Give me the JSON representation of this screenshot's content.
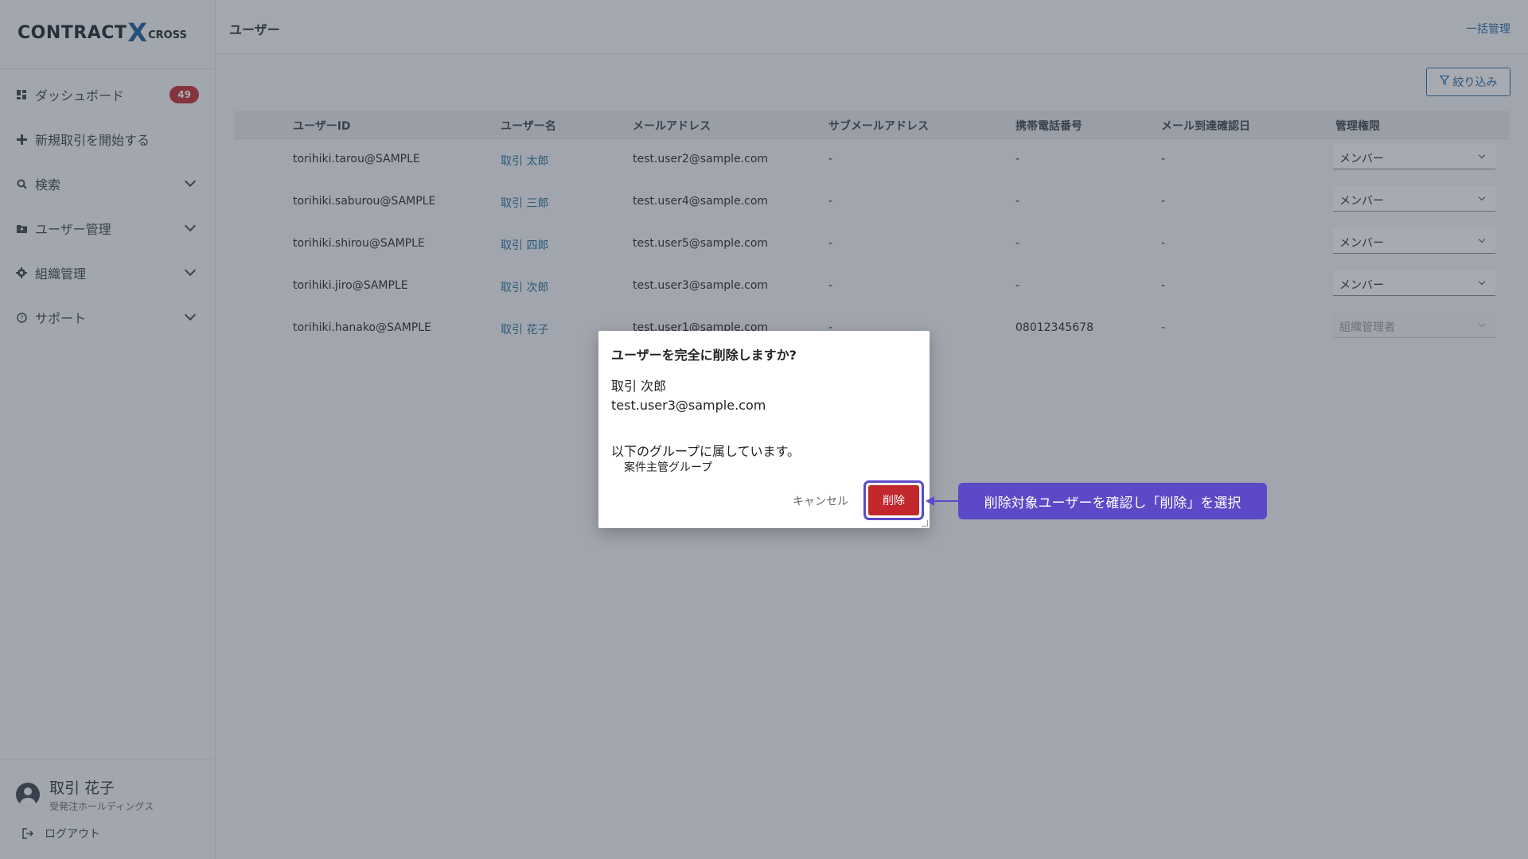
{
  "sidebar": {
    "logo": {
      "main": "CONTRACT",
      "x": "X",
      "sub": "CROSS"
    },
    "items": [
      {
        "label": "ダッシュボード",
        "badge": "49"
      },
      {
        "label": "新規取引を開始する"
      },
      {
        "label": "検索"
      },
      {
        "label": "ユーザー管理"
      },
      {
        "label": "組織管理"
      },
      {
        "label": "サポート"
      }
    ],
    "profile": {
      "name": "取引 花子",
      "org": "受発注ホールディングス"
    },
    "logout_label": "ログアウト"
  },
  "header": {
    "title": "ユーザー",
    "bulk_label": "一括管理"
  },
  "toolbar": {
    "filter_label": "絞り込み"
  },
  "table": {
    "columns": [
      "ユーザーID",
      "ユーザー名",
      "メールアドレス",
      "サブメールアドレス",
      "携帯電話番号",
      "メール到達確認日",
      "管理権限"
    ],
    "rows": [
      {
        "id": "torihiki.tarou@SAMPLE",
        "name": "取引 太郎",
        "email": "test.user2@sample.com",
        "sub_email": "-",
        "phone": "-",
        "confirmed": "-",
        "role": "メンバー",
        "disabled": false
      },
      {
        "id": "torihiki.saburou@SAMPLE",
        "name": "取引 三郎",
        "email": "test.user4@sample.com",
        "sub_email": "-",
        "phone": "-",
        "confirmed": "-",
        "role": "メンバー",
        "disabled": false
      },
      {
        "id": "torihiki.shirou@SAMPLE",
        "name": "取引 四郎",
        "email": "test.user5@sample.com",
        "sub_email": "-",
        "phone": "-",
        "confirmed": "-",
        "role": "メンバー",
        "disabled": false
      },
      {
        "id": "torihiki.jiro@SAMPLE",
        "name": "取引 次郎",
        "email": "test.user3@sample.com",
        "sub_email": "-",
        "phone": "-",
        "confirmed": "-",
        "role": "メンバー",
        "disabled": false
      },
      {
        "id": "torihiki.hanako@SAMPLE",
        "name": "取引 花子",
        "email": "test.user1@sample.com",
        "sub_email": "-",
        "phone": "08012345678",
        "confirmed": "-",
        "role": "組織管理者",
        "disabled": true
      }
    ]
  },
  "modal": {
    "title": "ユーザーを完全に削除しますか?",
    "user_name": "取引 次郎",
    "user_email": "test.user3@sample.com",
    "group_label": "以下のグループに属しています。",
    "group_name": "案件主管グループ",
    "cancel_label": "キャンセル",
    "delete_label": "削除"
  },
  "annotation": {
    "text": "削除対象ユーザーを確認し「削除」を選択"
  },
  "colors": {
    "accent": "#1e64a8",
    "danger": "#c2272d",
    "annotation": "#5b49c7"
  }
}
